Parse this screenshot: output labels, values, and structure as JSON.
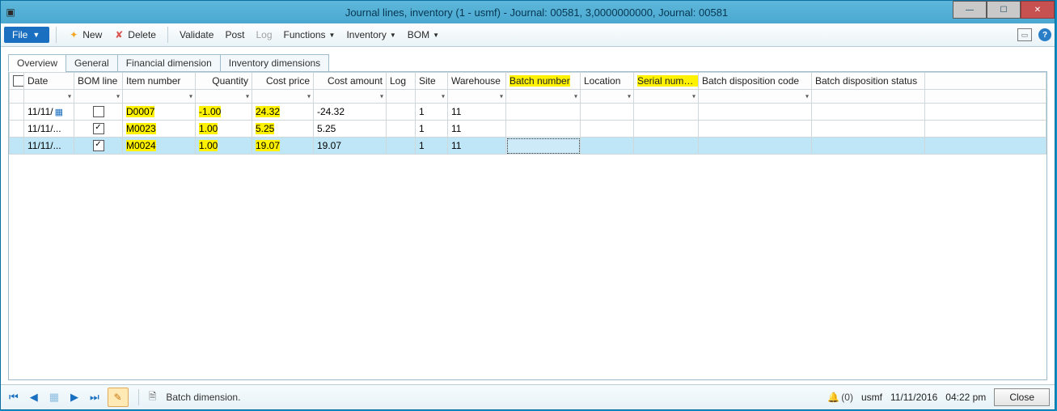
{
  "window": {
    "title": "Journal lines, inventory (1 - usmf) - Journal: 00581, 3,0000000000, Journal: 00581"
  },
  "toolbar": {
    "file": "File",
    "new": "New",
    "delete": "Delete",
    "validate": "Validate",
    "post": "Post",
    "log": "Log",
    "functions": "Functions",
    "inventory": "Inventory",
    "bom": "BOM"
  },
  "tabs": {
    "overview": "Overview",
    "general": "General",
    "financial": "Financial dimension",
    "invdim": "Inventory dimensions"
  },
  "columns": {
    "date": "Date",
    "bomline": "BOM line",
    "item": "Item number",
    "qty": "Quantity",
    "costprice": "Cost price",
    "costamount": "Cost amount",
    "log": "Log",
    "site": "Site",
    "warehouse": "Warehouse",
    "batch": "Batch number",
    "location": "Location",
    "serial": "Serial number",
    "dispcode": "Batch disposition code",
    "dispstatus": "Batch disposition status"
  },
  "rows": [
    {
      "date": "11/11/",
      "bomline": false,
      "item": "D0007",
      "qty": "-1.00",
      "costprice": "24.32",
      "costamount": "-24.32",
      "log": "",
      "site": "1",
      "warehouse": "11",
      "batch": "",
      "location": "",
      "serial": "",
      "dispcode": "",
      "dispstatus": "",
      "highlight": true,
      "hasCalendar": true
    },
    {
      "date": "11/11/...",
      "bomline": true,
      "item": "M0023",
      "qty": "1.00",
      "costprice": "5.25",
      "costamount": "5.25",
      "log": "",
      "site": "1",
      "warehouse": "11",
      "batch": "",
      "location": "",
      "serial": "",
      "dispcode": "",
      "dispstatus": "",
      "highlight": true
    },
    {
      "date": "11/11/...",
      "bomline": true,
      "item": "M0024",
      "qty": "1.00",
      "costprice": "19.07",
      "costamount": "19.07",
      "log": "",
      "site": "1",
      "warehouse": "11",
      "batch": "",
      "location": "",
      "serial": "",
      "dispcode": "",
      "dispstatus": "",
      "selected": true,
      "highlight": true
    }
  ],
  "status": {
    "hint": "Batch dimension.",
    "alerts": "(0)",
    "company": "usmf",
    "date": "11/11/2016",
    "time": "04:22 pm",
    "close": "Close"
  }
}
